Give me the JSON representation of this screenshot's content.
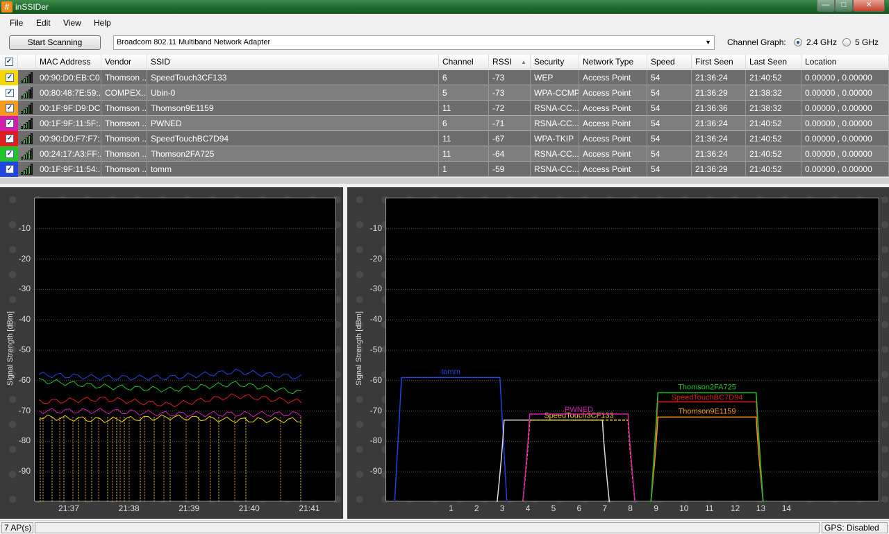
{
  "window": {
    "title": "inSSIDer",
    "app_icon": "#"
  },
  "menu": [
    {
      "label": "File"
    },
    {
      "label": "Edit"
    },
    {
      "label": "View"
    },
    {
      "label": "Help"
    }
  ],
  "toolbar": {
    "start_label": "Start Scanning",
    "adapter": "Broadcom 802.11 Multiband Network Adapter",
    "channel_graph_label": "Channel Graph:",
    "band_24": "2.4 GHz",
    "band_5": "5 GHz",
    "selected_band": "2.4 GHz"
  },
  "table": {
    "columns": [
      "MAC Address",
      "Vendor",
      "SSID",
      "Channel",
      "RSSI",
      "Security",
      "Network Type",
      "Speed",
      "First Seen",
      "Last Seen",
      "Location"
    ],
    "rows": [
      {
        "color": "#f5d800",
        "mac": "00:90:D0:EB:C0...",
        "vendor": "Thomson ...",
        "ssid": "SpeedTouch3CF133",
        "channel": "6",
        "rssi": "-73",
        "security": "WEP",
        "type": "Access Point",
        "speed": "54",
        "first": "21:36:24",
        "last": "21:40:52",
        "location": "0.00000 , 0.00000",
        "bars": 3
      },
      {
        "color": "#ffffff",
        "mac": "00:80:48:7E:59:...",
        "vendor": "COMPEX...",
        "ssid": "Ubin-0",
        "channel": "5",
        "rssi": "-73",
        "security": "WPA-CCMP",
        "type": "Access Point",
        "speed": "54",
        "first": "21:36:29",
        "last": "21:38:32",
        "location": "0.00000 , 0.00000",
        "bars": 3
      },
      {
        "color": "#f59a1c",
        "mac": "00:1F:9F:D9:DC...",
        "vendor": "Thomson ...",
        "ssid": "Thomson9E1159",
        "channel": "11",
        "rssi": "-72",
        "security": "RSNA-CC...",
        "type": "Access Point",
        "speed": "54",
        "first": "21:36:36",
        "last": "21:38:32",
        "location": "0.00000 , 0.00000",
        "bars": 3
      },
      {
        "color": "#d21ea8",
        "mac": "00:1F:9F:11:5F:...",
        "vendor": "Thomson ...",
        "ssid": "PWNED",
        "channel": "6",
        "rssi": "-71",
        "security": "RSNA-CC...",
        "type": "Access Point",
        "speed": "54",
        "first": "21:36:24",
        "last": "21:40:52",
        "location": "0.00000 , 0.00000",
        "bars": 3
      },
      {
        "color": "#e01c1c",
        "mac": "00:90:D0:F7:F7:...",
        "vendor": "Thomson ...",
        "ssid": "SpeedTouchBC7D94",
        "channel": "11",
        "rssi": "-67",
        "security": "WPA-TKIP",
        "type": "Access Point",
        "speed": "54",
        "first": "21:36:24",
        "last": "21:40:52",
        "location": "0.00000 , 0.00000",
        "bars": 4
      },
      {
        "color": "#22c42a",
        "mac": "00:24:17:A3:FF:...",
        "vendor": "Thomson ...",
        "ssid": "Thomson2FA725",
        "channel": "11",
        "rssi": "-64",
        "security": "RSNA-CC...",
        "type": "Access Point",
        "speed": "54",
        "first": "21:36:24",
        "last": "21:40:52",
        "location": "0.00000 , 0.00000",
        "bars": 4
      },
      {
        "color": "#2244e0",
        "mac": "00:1F:9F:11:54:...",
        "vendor": "Thomson ...",
        "ssid": "tomm",
        "channel": "1",
        "rssi": "-59",
        "security": "RSNA-CC...",
        "type": "Access Point",
        "speed": "54",
        "first": "21:36:29",
        "last": "21:40:52",
        "location": "0.00000 , 0.00000",
        "bars": 4
      }
    ]
  },
  "time_graph": {
    "ylabel": "Signal Strength [dBm]",
    "y_ticks": [
      "-10",
      "-20",
      "-30",
      "-40",
      "-50",
      "-60",
      "-70",
      "-80",
      "-90"
    ],
    "x_ticks": [
      "21:37",
      "21:38",
      "21:39",
      "21:40",
      "21:41"
    ]
  },
  "channel_graph": {
    "ylabel": "Signal Strength [dBm]",
    "y_ticks": [
      "-10",
      "-20",
      "-30",
      "-40",
      "-50",
      "-60",
      "-70",
      "-80",
      "-90"
    ],
    "x_ticks": [
      "1",
      "2",
      "3",
      "4",
      "5",
      "6",
      "7",
      "8",
      "9",
      "10",
      "11",
      "12",
      "13",
      "14"
    ]
  },
  "chart_data": [
    {
      "type": "line",
      "ylabel": "Signal Strength [dBm]",
      "x": [
        "21:37",
        "21:38",
        "21:39",
        "21:40",
        "21:41"
      ],
      "ylim": [
        -100,
        0
      ],
      "series": [
        {
          "name": "tomm",
          "values": [
            -58,
            -59,
            -59,
            -57,
            -59
          ],
          "color": "#2244e0"
        },
        {
          "name": "Thomson2FA725",
          "values": [
            -60,
            -62,
            -63,
            -61,
            -64
          ],
          "color": "#22c42a"
        },
        {
          "name": "SpeedTouchBC7D94",
          "values": [
            -67,
            -66,
            -68,
            -65,
            -67
          ],
          "color": "#e01c1c"
        },
        {
          "name": "PWNED",
          "values": [
            -70,
            -70,
            -71,
            -71,
            -71
          ],
          "color": "#d21ea8"
        },
        {
          "name": "SpeedTouch3CF133",
          "values": [
            -72,
            -73,
            -72,
            -73,
            -73
          ],
          "color": "#f5d800"
        }
      ]
    },
    {
      "type": "area",
      "ylabel": "Signal Strength [dBm]",
      "x_ticks": [
        1,
        2,
        3,
        4,
        5,
        6,
        7,
        8,
        9,
        10,
        11,
        12,
        13,
        14
      ],
      "ylim": [
        -100,
        0
      ],
      "series": [
        {
          "name": "tomm",
          "channel": 1,
          "rssi": -59,
          "color": "#2244e0"
        },
        {
          "name": "Ubin-0",
          "channel": 5,
          "rssi": -73,
          "color": "#dddddd"
        },
        {
          "name": "SpeedTouch3CF133",
          "channel": 6,
          "rssi": -73,
          "color": "#f5d800"
        },
        {
          "name": "PWNED",
          "channel": 6,
          "rssi": -71,
          "color": "#d21ea8"
        },
        {
          "name": "Thomson9E1159",
          "channel": 11,
          "rssi": -72,
          "color": "#f59a1c"
        },
        {
          "name": "SpeedTouchBC7D94",
          "channel": 11,
          "rssi": -67,
          "color": "#e01c1c"
        },
        {
          "name": "Thomson2FA725",
          "channel": 11,
          "rssi": -64,
          "color": "#22c42a"
        }
      ]
    }
  ],
  "status": {
    "aps": "7 AP(s)",
    "gps": "GPS: Disabled"
  }
}
